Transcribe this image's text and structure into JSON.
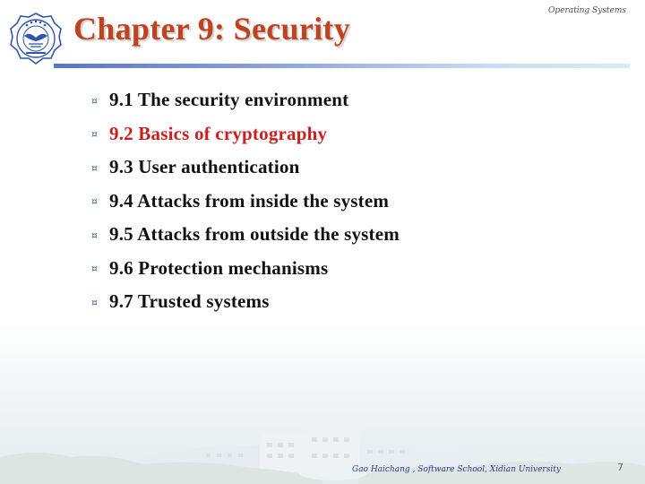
{
  "header": {
    "title": "Chapter 9: Security",
    "course": "Operating Systems",
    "logo_icon": "university-seal-icon"
  },
  "bullet_glyph": "¤",
  "bullets": [
    {
      "label": "9.1 The security environment",
      "highlighted": false
    },
    {
      "label": "9.2 Basics of cryptography",
      "highlighted": true
    },
    {
      "label": "9.3 User authentication",
      "highlighted": false
    },
    {
      "label": "9.4 Attacks from inside the system",
      "highlighted": false
    },
    {
      "label": "9.5 Attacks from outside the system",
      "highlighted": false
    },
    {
      "label": "9.6 Protection mechanisms",
      "highlighted": false
    },
    {
      "label": "9.7 Trusted systems",
      "highlighted": false
    }
  ],
  "footer": {
    "author": "Gao Haichang , Software School, Xidian University",
    "page": "7"
  },
  "colors": {
    "title": "#c0431f",
    "highlight": "#c8201e",
    "text": "#111111",
    "footer": "#2d3a8a"
  }
}
